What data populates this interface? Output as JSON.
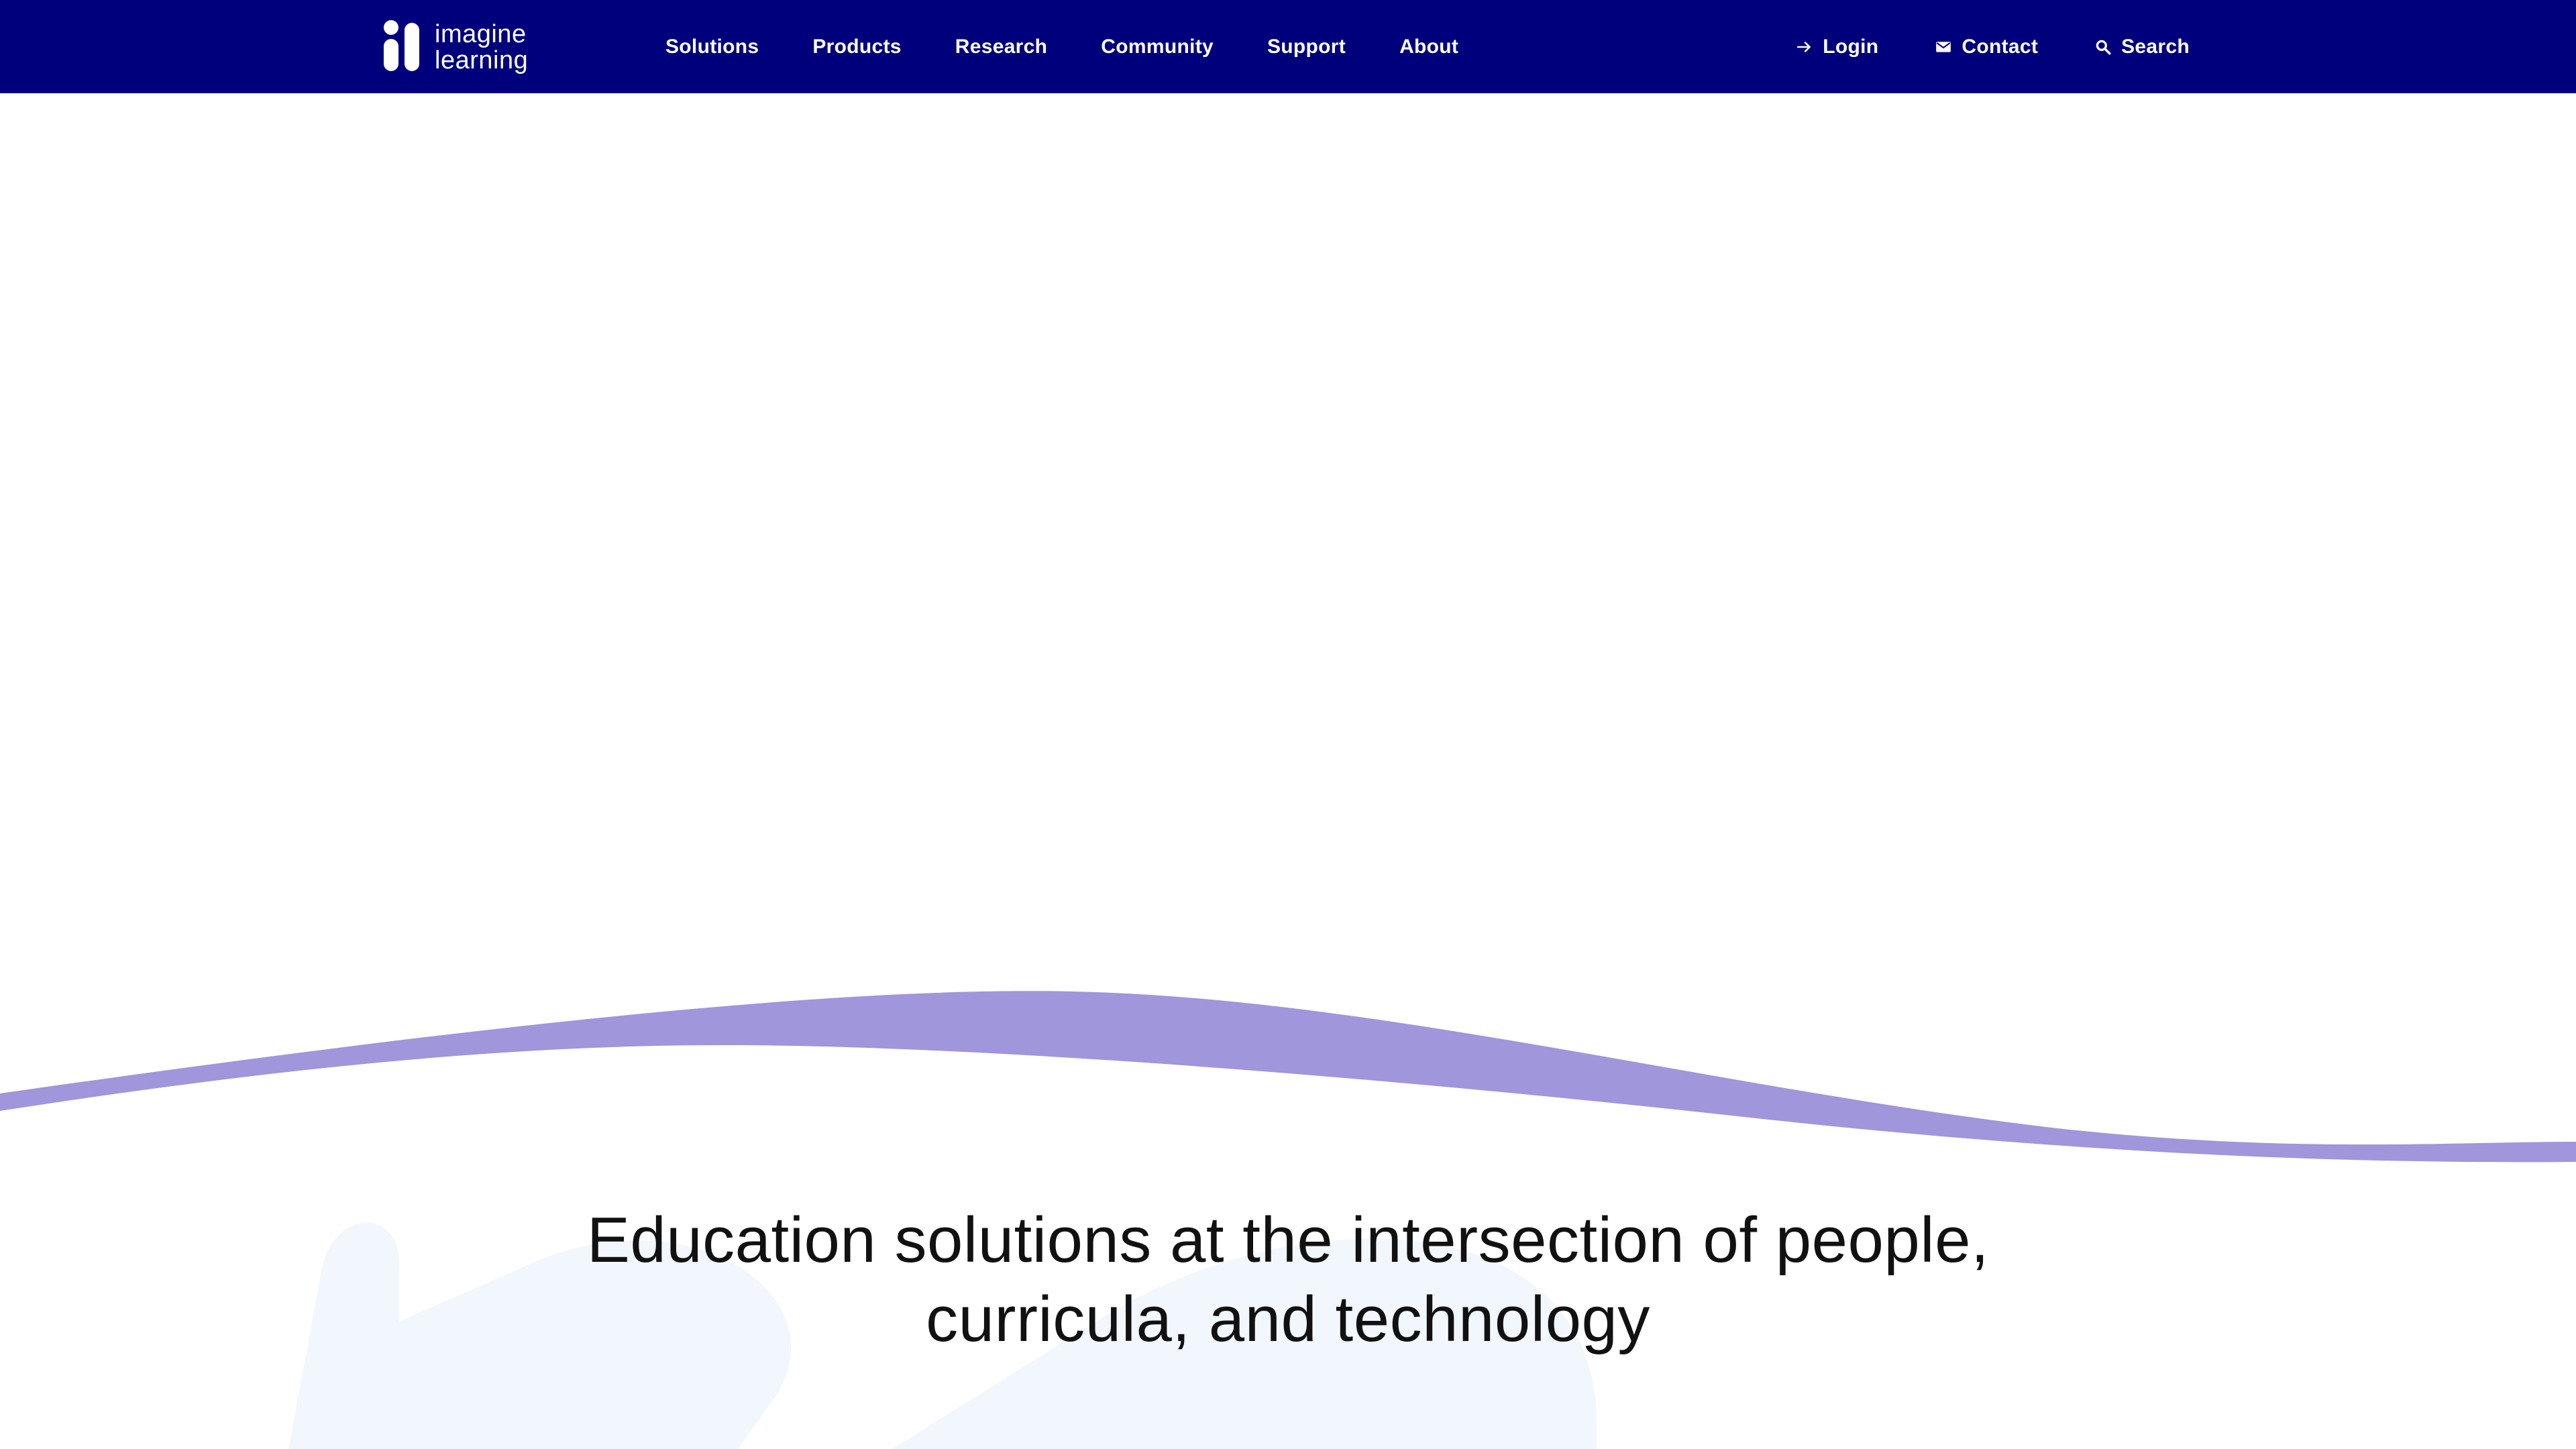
{
  "logo": {
    "line1": "imagine",
    "line2": "learning"
  },
  "nav": {
    "items": [
      "Solutions",
      "Products",
      "Research",
      "Community",
      "Support",
      "About"
    ]
  },
  "util": {
    "login": "Login",
    "contact": "Contact",
    "search": "Search",
    "login_icon": "arrow-right-icon",
    "contact_icon": "mail-icon",
    "search_icon": "search-icon"
  },
  "hero": {
    "line1": "Education solutions at the intersection of people,",
    "line2": "curricula, and technology"
  },
  "colors": {
    "nav_bg": "#00007d",
    "wave": "#a096dc",
    "bg_shape": "#f2f6fd"
  }
}
